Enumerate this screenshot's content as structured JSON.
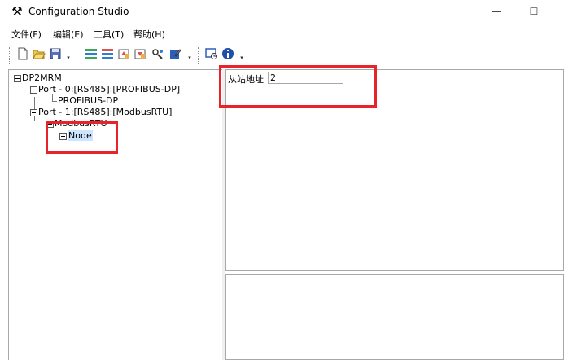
{
  "window": {
    "title": "Configuration Studio",
    "app_icon": "wrench-hammer-icon",
    "minimize_glyph": "—",
    "maximize_glyph": "☐"
  },
  "menu": {
    "items": [
      "文件(F)",
      "编辑(E)",
      "工具(T)",
      "帮助(H)"
    ]
  },
  "toolbar": {
    "buttons": [
      "new-file-icon",
      "open-folder-icon",
      "save-icon",
      "config-list-icon",
      "config-download-icon",
      "upload-icon",
      "download-icon",
      "settings-icon",
      "edit-icon",
      "monitor-icon",
      "info-icon"
    ],
    "dropdown_glyph": "▾"
  },
  "tree": {
    "root": "DP2MRM",
    "port0": "Port - 0:[RS485]:[PROFIBUS-DP]",
    "port0_child": "PROFIBUS-DP",
    "port1": "Port - 1:[RS485]:[ModbusRTU]",
    "port1_child": "ModbusRTU",
    "node": "Node"
  },
  "properties": {
    "slave_address_label": "从站地址",
    "slave_address_value": "2"
  },
  "colors": {
    "annotation": "#e8242a",
    "selection": "#cde4ff",
    "border": "#a8a8a8"
  }
}
